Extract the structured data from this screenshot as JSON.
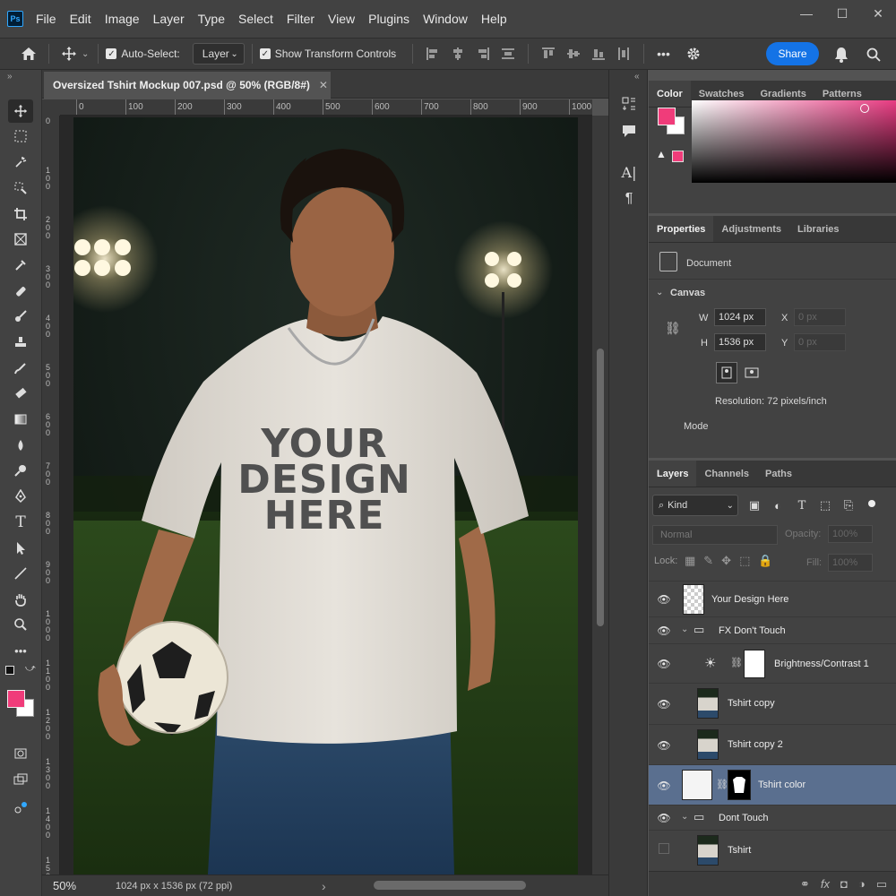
{
  "app": {
    "logo": "Ps",
    "menu": [
      "File",
      "Edit",
      "Image",
      "Layer",
      "Type",
      "Select",
      "Filter",
      "View",
      "Plugins",
      "Window",
      "Help"
    ],
    "window_controls": [
      "—",
      "☐",
      "✕"
    ]
  },
  "options_bar": {
    "auto_select_label": "Auto-Select:",
    "auto_select_target": "Layer",
    "show_transform_label": "Show Transform Controls",
    "more_label": "•••",
    "share_label": "Share"
  },
  "document": {
    "tab_title": "Oversized Tshirt Mockup 007.psd @ 50% (RGB/8#)",
    "close_glyph": "✕",
    "zoom": "50%",
    "doc_info": "1024 px x 1536 px (72 ppi)",
    "status_arrow": "›",
    "ruler_h": [
      "0",
      "100",
      "200",
      "300",
      "400",
      "500",
      "600",
      "700",
      "800",
      "900",
      "1000"
    ],
    "ruler_v": [
      "0",
      "1 0 0",
      "2 0 0",
      "3 0 0",
      "4 0 0",
      "5 0 0",
      "6 0 0",
      "7 0 0",
      "8 0 0",
      "9 0 0",
      "1 0 0 0",
      "1 1 0 0",
      "1 2 0 0",
      "1 3 0 0",
      "1 4 0 0",
      "1 5 0 0"
    ],
    "shirt_text": [
      "YOUR",
      "DESIGN",
      "HERE"
    ]
  },
  "color_panel": {
    "tabs": [
      "Color",
      "Swatches",
      "Gradients",
      "Patterns"
    ],
    "foreground": "#f03c7a",
    "background": "#ffffff",
    "gamut_warning": "▲"
  },
  "properties_panel": {
    "tabs": [
      "Properties",
      "Adjustments",
      "Libraries"
    ],
    "document_label": "Document",
    "canvas_label": "Canvas",
    "w_label": "W",
    "w_value": "1024 px",
    "h_label": "H",
    "h_value": "1536 px",
    "x_label": "X",
    "x_value": "0 px",
    "y_label": "Y",
    "y_value": "0 px",
    "resolution": "Resolution: 72 pixels/inch",
    "mode_label": "Mode"
  },
  "layers_panel": {
    "tabs": [
      "Layers",
      "Channels",
      "Paths"
    ],
    "filter_kind": "Kind",
    "blend_mode": "Normal",
    "opacity_label": "Opacity:",
    "opacity_value": "100%",
    "lock_label": "Lock:",
    "fill_label": "Fill:",
    "fill_value": "100%",
    "layers": [
      {
        "name": "Your Design Here",
        "visible": true,
        "type": "smart-object"
      },
      {
        "name": "FX Don't Touch",
        "visible": true,
        "type": "group"
      },
      {
        "name": "Brightness/Contrast 1",
        "visible": true,
        "type": "adjustment"
      },
      {
        "name": "Tshirt copy",
        "visible": true,
        "type": "image"
      },
      {
        "name": "Tshirt copy 2",
        "visible": true,
        "type": "image"
      },
      {
        "name": "Tshirt color",
        "visible": true,
        "type": "fill-with-mask",
        "selected": true
      },
      {
        "name": "Dont Touch",
        "visible": true,
        "type": "group"
      },
      {
        "name": "Tshirt",
        "visible": false,
        "type": "image"
      }
    ],
    "bottom_icons": [
      "link-icon",
      "fx-icon",
      "mask-icon",
      "adjustment-icon",
      "folder-icon"
    ]
  },
  "colors": {
    "accent_blue": "#1473e6",
    "selection": "#5a6f8f",
    "foreground_pink": "#f03c7a"
  }
}
